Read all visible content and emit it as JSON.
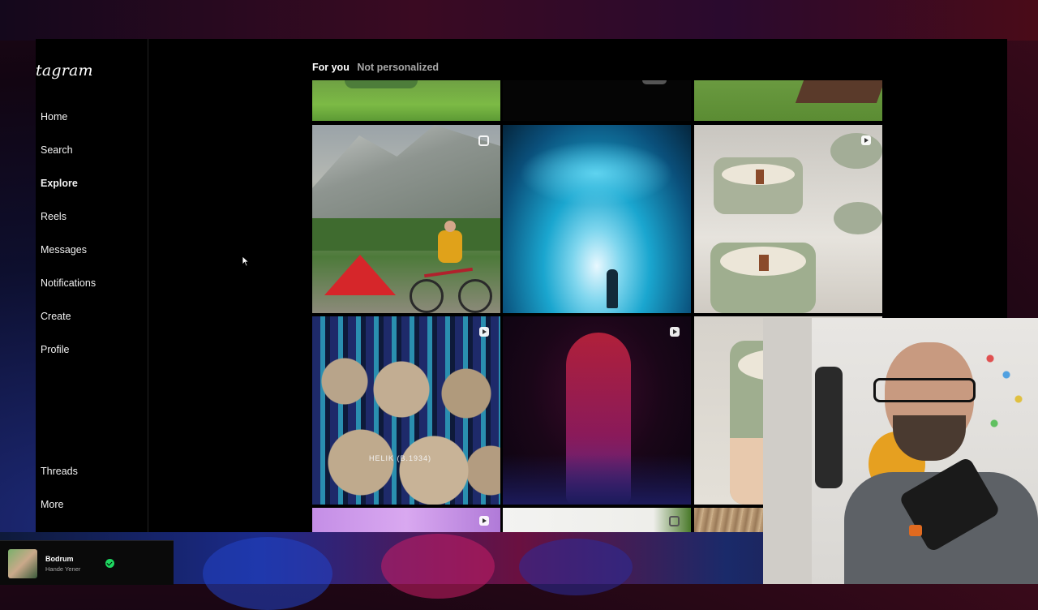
{
  "app": {
    "logo_text": "tagram"
  },
  "sidebar": {
    "items": [
      {
        "label": "Home",
        "icon": "home-icon"
      },
      {
        "label": "Search",
        "icon": "search-icon"
      },
      {
        "label": "Explore",
        "icon": "explore-icon",
        "active": true
      },
      {
        "label": "Reels",
        "icon": "reels-icon"
      },
      {
        "label": "Messages",
        "icon": "messages-icon"
      },
      {
        "label": "Notifications",
        "icon": "heart-icon"
      },
      {
        "label": "Create",
        "icon": "create-icon"
      },
      {
        "label": "Profile",
        "icon": "profile-icon"
      }
    ],
    "bottom_items": [
      {
        "label": "Threads",
        "icon": "threads-icon"
      },
      {
        "label": "More",
        "icon": "menu-icon"
      }
    ]
  },
  "tabs": [
    {
      "label": "For you",
      "active": true
    },
    {
      "label": "Not personalized",
      "active": false
    }
  ],
  "grid": {
    "tiles": [
      {
        "subject": "green meadow",
        "badge": null
      },
      {
        "subject": "dark photo",
        "badge": null
      },
      {
        "subject": "grass field",
        "badge": null
      },
      {
        "subject": "mountain camping with bicycle and red tent",
        "badge": "carousel"
      },
      {
        "subject": "blue ice cave",
        "badge": null
      },
      {
        "subject": "green ceramic candles",
        "badge": "reel"
      },
      {
        "subject": "yarn spools",
        "badge": "reel",
        "overlay_text": "HELIK (B.1934)"
      },
      {
        "subject": "red lit figure in dark",
        "badge": "reel"
      },
      {
        "subject": "pink gradient",
        "badge": "reel"
      },
      {
        "subject": "white and green",
        "badge": "carousel"
      },
      {
        "subject": "wood texture",
        "badge": null
      }
    ]
  },
  "spotify": {
    "title": "Bodrum",
    "artist": "Hande Yener",
    "saved": true
  },
  "colors": {
    "panel_bg": "#000000",
    "text": "#f5f5f5",
    "dim_text": "#a8a8a8",
    "spotify_green": "#1ed760"
  }
}
